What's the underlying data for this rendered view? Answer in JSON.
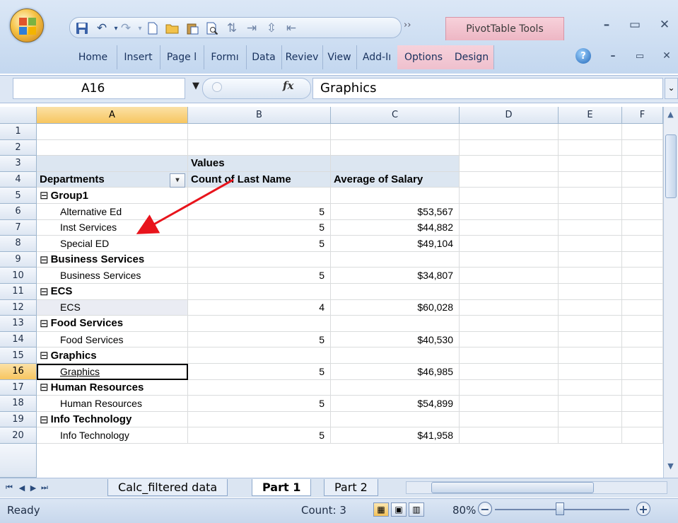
{
  "ribbon": {
    "context_tab_label": "PivotTable Tools",
    "tabs": [
      "Home",
      "Insert",
      "Page l",
      "Formı",
      "Data",
      "Reviev",
      "View",
      "Add-Iı",
      "Options",
      "Design"
    ]
  },
  "formula_bar": {
    "name_box": "A16",
    "fx_label": "fx",
    "value": "Graphics"
  },
  "columns": [
    "A",
    "B",
    "C",
    "D",
    "E",
    "F"
  ],
  "selected_column": "A",
  "selected_row": "16",
  "rows": [
    {
      "n": "1",
      "a": "",
      "b": "",
      "c": ""
    },
    {
      "n": "2",
      "a": "",
      "b": "",
      "c": ""
    },
    {
      "n": "3",
      "a": "",
      "b": "Values",
      "c": ""
    },
    {
      "n": "4",
      "a": "Departments",
      "b": "Count of Last Name",
      "c": "Average of Salary"
    },
    {
      "n": "5",
      "a": "Group1",
      "b": "",
      "c": ""
    },
    {
      "n": "6",
      "a": "Alternative Ed",
      "b": "5",
      "c": "$53,567"
    },
    {
      "n": "7",
      "a": "Inst Services",
      "b": "5",
      "c": "$44,882"
    },
    {
      "n": "8",
      "a": "Special ED",
      "b": "5",
      "c": "$49,104"
    },
    {
      "n": "9",
      "a": "Business Services",
      "b": "",
      "c": ""
    },
    {
      "n": "10",
      "a": "Business Services",
      "b": "5",
      "c": "$34,807"
    },
    {
      "n": "11",
      "a": "ECS",
      "b": "",
      "c": ""
    },
    {
      "n": "12",
      "a": "ECS",
      "b": "4",
      "c": "$60,028"
    },
    {
      "n": "13",
      "a": "Food Services",
      "b": "",
      "c": ""
    },
    {
      "n": "14",
      "a": "Food Services",
      "b": "5",
      "c": "$40,530"
    },
    {
      "n": "15",
      "a": "Graphics",
      "b": "",
      "c": ""
    },
    {
      "n": "16",
      "a": "Graphics",
      "b": "5",
      "c": "$46,985"
    },
    {
      "n": "17",
      "a": "Human Resources",
      "b": "",
      "c": ""
    },
    {
      "n": "18",
      "a": "Human Resources",
      "b": "5",
      "c": "$54,899"
    },
    {
      "n": "19",
      "a": "Info Technology",
      "b": "",
      "c": ""
    },
    {
      "n": "20",
      "a": "Info Technology",
      "b": "5",
      "c": "$41,958"
    }
  ],
  "sheet_tabs": [
    "Calc_filtered data",
    "Part 1",
    "Part 2"
  ],
  "active_sheet": "Part 1",
  "status": {
    "ready": "Ready",
    "count": "Count: 3",
    "zoom": "80%"
  },
  "colors": {
    "pivot_fill": "#dce6f1",
    "selection_header": "#f7c660",
    "annotation_arrow": "#e8141c"
  }
}
